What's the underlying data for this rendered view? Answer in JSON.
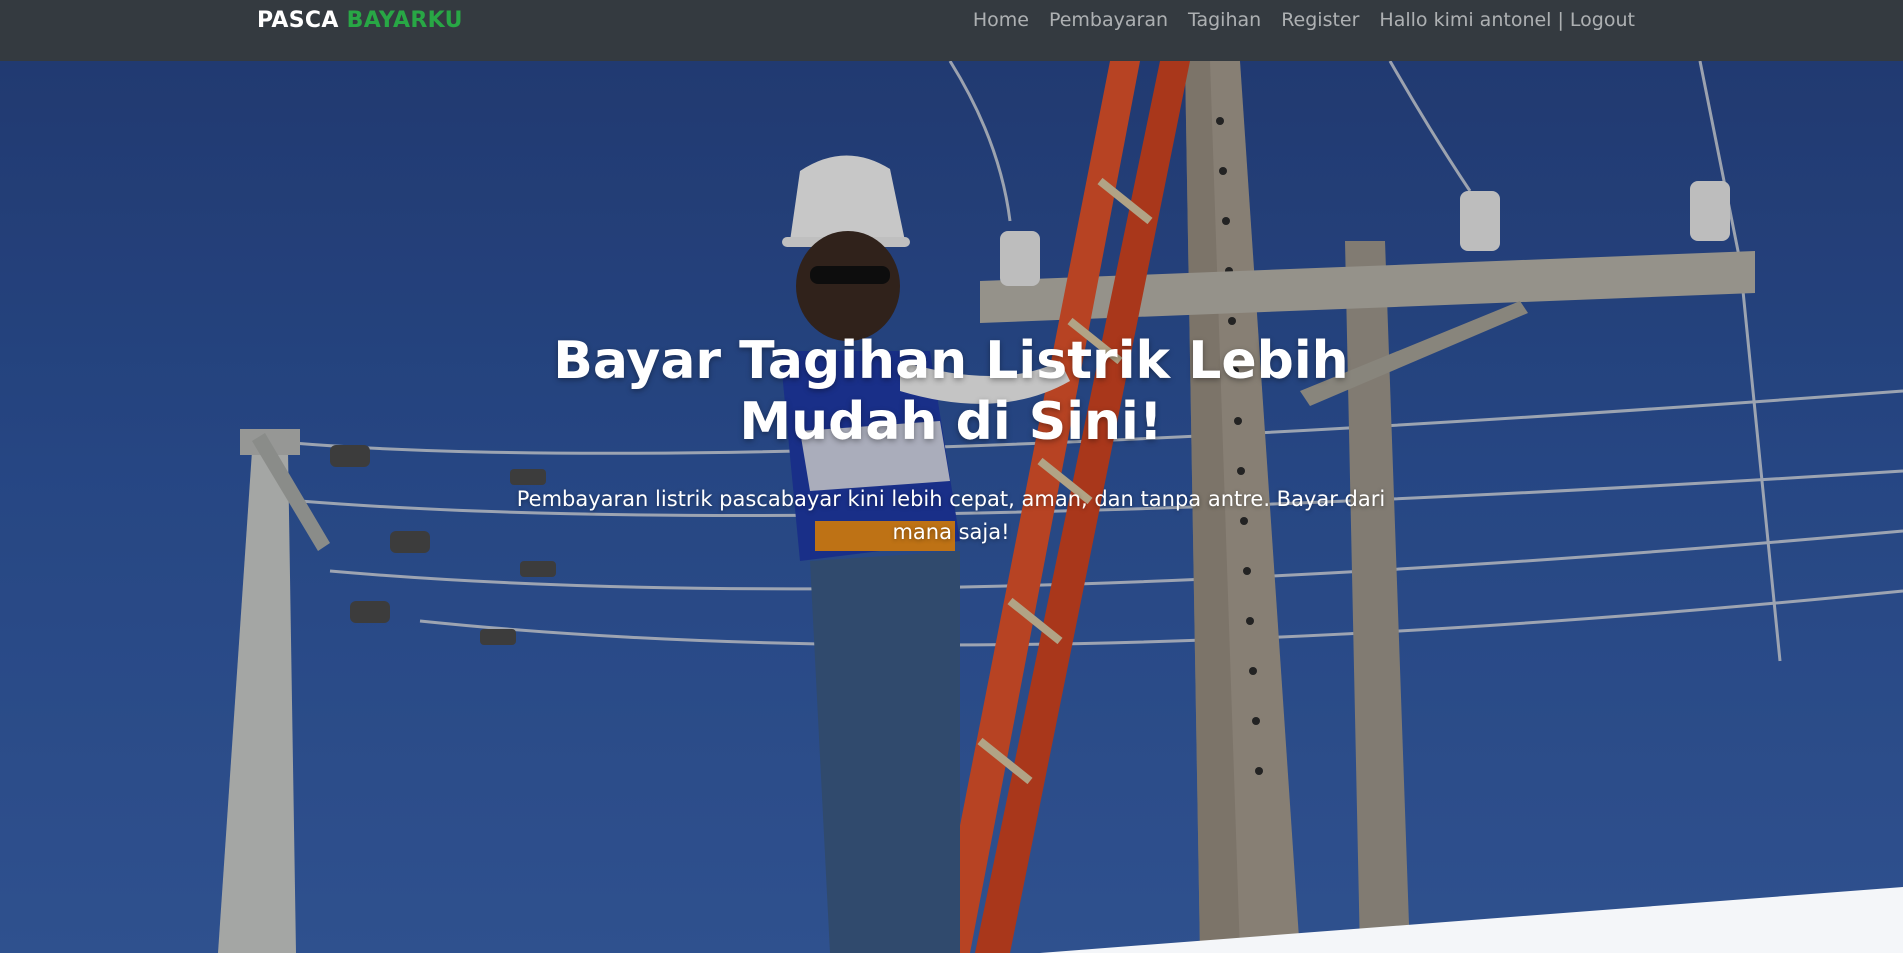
{
  "navbar": {
    "brand_primary": "PASCA",
    "brand_accent": "BAYARKU",
    "links": [
      {
        "label": "Home"
      },
      {
        "label": "Pembayaran"
      },
      {
        "label": "Tagihan"
      },
      {
        "label": "Register"
      },
      {
        "label": "Hallo kimi antonel | Logout"
      }
    ]
  },
  "hero": {
    "title": "Bayar Tagihan Listrik Lebih Mudah di Sini!",
    "subtitle": "Pembayaran listrik pascabayar kini lebih cepat, aman, dan tanpa antre. Bayar dari mana saja!"
  },
  "colors": {
    "navbar_bg": "#343a40",
    "brand_accent": "#28a745",
    "sky": "#2f56a0",
    "wave": "#f4f6f9"
  }
}
